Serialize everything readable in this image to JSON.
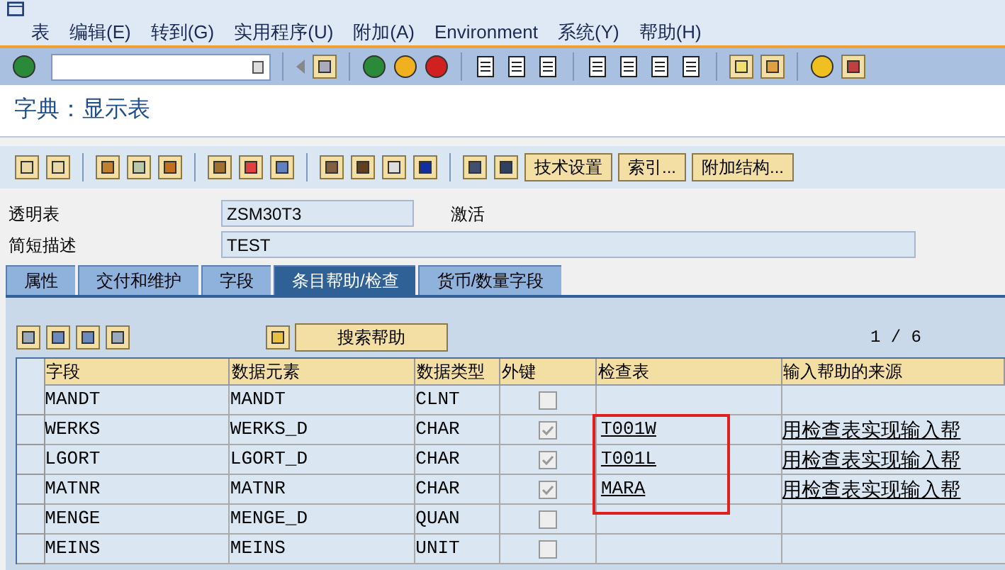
{
  "menu": [
    "表",
    "编辑(E)",
    "转到(G)",
    "实用程序(U)",
    "附加(A)",
    "Environment",
    "系统(Y)",
    "帮助(H)"
  ],
  "title": "字典：显示表",
  "app_buttons": [
    "技术设置",
    "索引...",
    "附加结构..."
  ],
  "form": [
    {
      "label": "透明表",
      "value": "ZSM30T3",
      "status": "激活"
    },
    {
      "label": "简短描述",
      "value": "TEST"
    }
  ],
  "tabs": [
    {
      "label": "属性",
      "selected": false
    },
    {
      "label": "交付和维护",
      "selected": false
    },
    {
      "label": "字段",
      "selected": false
    },
    {
      "label": "条目帮助/检查",
      "selected": true
    },
    {
      "label": "货币/数量字段",
      "selected": false
    }
  ],
  "search_help_button": "搜索帮助",
  "page_counter": "1 / 6",
  "table": {
    "columns": [
      "字段",
      "数据元素",
      "数据类型",
      "外键",
      "检查表",
      "输入帮助的来源"
    ],
    "rows": [
      {
        "field": "MANDT",
        "element": "MANDT",
        "type": "CLNT",
        "foreign_key": false,
        "check_table": "",
        "source": "",
        "marked": false
      },
      {
        "field": "WERKS",
        "element": "WERKS_D",
        "type": "CHAR",
        "foreign_key": true,
        "check_table": "T001W",
        "source": "用检查表实现输入帮",
        "marked": true
      },
      {
        "field": "LGORT",
        "element": "LGORT_D",
        "type": "CHAR",
        "foreign_key": true,
        "check_table": "T001L",
        "source": "用检查表实现输入帮",
        "marked": true
      },
      {
        "field": "MATNR",
        "element": "MATNR",
        "type": "CHAR",
        "foreign_key": true,
        "check_table": "MARA",
        "source": "用检查表实现输入帮",
        "marked": true
      },
      {
        "field": "MENGE",
        "element": "MENGE_D",
        "type": "QUAN",
        "foreign_key": false,
        "check_table": "",
        "source": "",
        "marked": false
      },
      {
        "field": "MEINS",
        "element": "MEINS",
        "type": "UNIT",
        "foreign_key": false,
        "check_table": "",
        "source": "",
        "marked": false
      }
    ]
  }
}
